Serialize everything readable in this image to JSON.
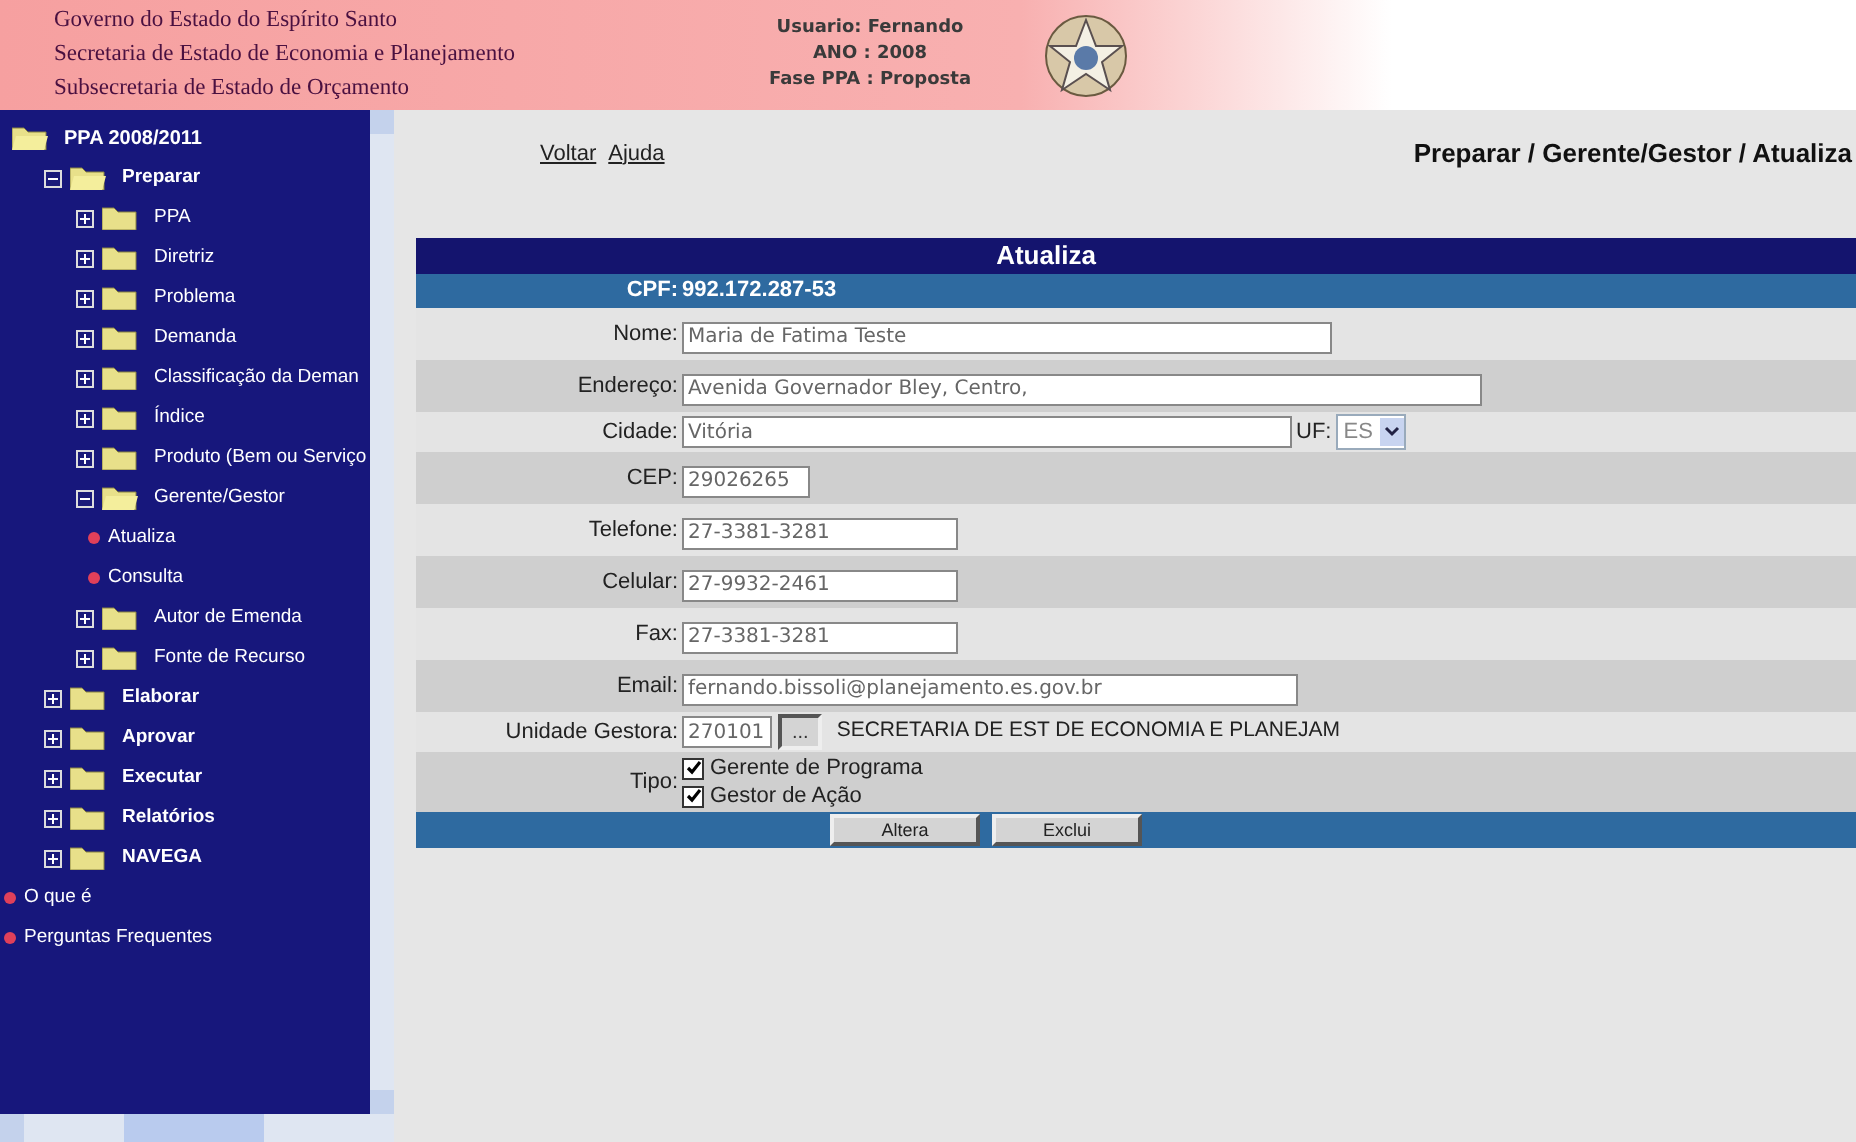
{
  "header": {
    "lines": [
      "Governo do Estado do Espírito Santo",
      "Secretaria de Estado de Economia e Planejamento",
      "Subsecretaria de Estado de Orçamento"
    ],
    "info": [
      "Usuario: Fernando",
      "ANO : 2008",
      "Fase PPA : Proposta"
    ]
  },
  "sidebar": {
    "tree": [
      {
        "kind": "root",
        "label": "PPA 2008/2011",
        "children": [
          {
            "kind": "folder",
            "label": "Preparar",
            "expanded": true,
            "children": [
              {
                "kind": "folder",
                "label": "PPA",
                "expanded": false
              },
              {
                "kind": "folder",
                "label": "Diretriz",
                "expanded": false
              },
              {
                "kind": "folder",
                "label": "Problema",
                "expanded": false
              },
              {
                "kind": "folder",
                "label": "Demanda",
                "expanded": false
              },
              {
                "kind": "folder",
                "label": "Classificação da Deman",
                "expanded": false
              },
              {
                "kind": "folder",
                "label": "Índice",
                "expanded": false
              },
              {
                "kind": "folder",
                "label": "Produto (Bem ou Serviço",
                "expanded": false
              },
              {
                "kind": "folder",
                "label": "Gerente/Gestor",
                "expanded": true,
                "children": [
                  {
                    "kind": "leaf",
                    "label": "Atualiza"
                  },
                  {
                    "kind": "leaf",
                    "label": "Consulta"
                  }
                ]
              },
              {
                "kind": "folder",
                "label": "Autor de Emenda",
                "expanded": false
              },
              {
                "kind": "folder",
                "label": "Fonte de Recurso",
                "expanded": false
              }
            ]
          },
          {
            "kind": "folder",
            "label": "Elaborar",
            "expanded": false
          },
          {
            "kind": "folder",
            "label": "Aprovar",
            "expanded": false
          },
          {
            "kind": "folder",
            "label": "Executar",
            "expanded": false
          },
          {
            "kind": "folder",
            "label": "Relatórios",
            "expanded": false
          },
          {
            "kind": "folder",
            "label": "NAVEGA",
            "expanded": false
          }
        ]
      },
      {
        "kind": "leaf",
        "label": "O que é"
      },
      {
        "kind": "leaf",
        "label": "Perguntas Frequentes"
      }
    ]
  },
  "nav": {
    "links": [
      "Voltar",
      "Ajuda"
    ],
    "breadcrumb": "Preparar / Gerente/Gestor / Atualiza"
  },
  "form": {
    "title": "Atualiza",
    "cpf": {
      "label": "CPF:",
      "value": "992.172.287-53"
    },
    "fields": [
      {
        "kind": "text",
        "label": "Nome:",
        "value": "Maria de Fatima Teste"
      },
      {
        "kind": "text",
        "label": "Endereço:",
        "value": "Avenida Governador Bley, Centro,"
      },
      {
        "kind": "city",
        "label": "Cidade:",
        "value": "Vitória",
        "uf_label": "UF:",
        "uf_value": "ES"
      },
      {
        "kind": "text",
        "label": "CEP:",
        "value": "29026265"
      },
      {
        "kind": "text",
        "label": "Telefone:",
        "value": "27-3381-3281"
      },
      {
        "kind": "text",
        "label": "Celular:",
        "value": "27-9932-2461"
      },
      {
        "kind": "text",
        "label": "Fax:",
        "value": "27-3381-3281"
      },
      {
        "kind": "text",
        "label": "Email:",
        "value": "fernando.bissoli@planejamento.es.gov.br"
      },
      {
        "kind": "lookup",
        "label": "Unidade Gestora:",
        "value": "270101",
        "button": "...",
        "description": "SECRETARIA DE EST DE ECONOMIA E PLANEJAM"
      },
      {
        "kind": "checks",
        "label": "Tipo:",
        "options": [
          {
            "label": "Gerente de Programa",
            "checked": true
          },
          {
            "label": "Gestor de Ação",
            "checked": true
          }
        ]
      }
    ],
    "buttons": [
      "Altera",
      "Exclui"
    ]
  }
}
